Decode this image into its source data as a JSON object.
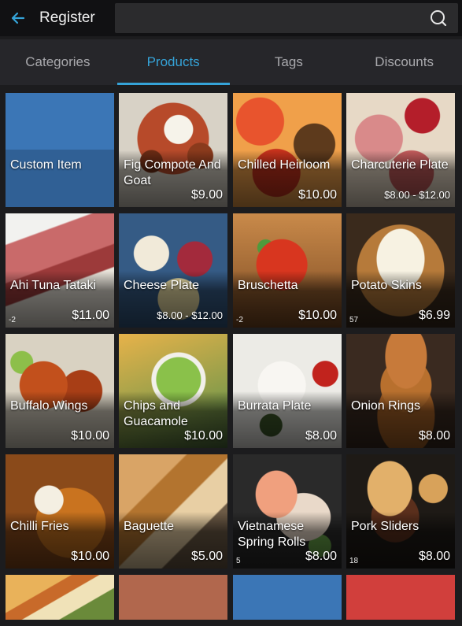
{
  "header": {
    "title": "Register",
    "search_placeholder": ""
  },
  "tabs": [
    {
      "label": "Categories",
      "active": false
    },
    {
      "label": "Products",
      "active": true
    },
    {
      "label": "Tags",
      "active": false
    },
    {
      "label": "Discounts",
      "active": false
    }
  ],
  "products": [
    {
      "name": "Custom Item",
      "price": "",
      "stock": "",
      "image": "solid-blue"
    },
    {
      "name": "Fig Compote And Goat",
      "price": "$9.00",
      "stock": "",
      "image": "fig-compote-photo"
    },
    {
      "name": "Chilled Heirloom",
      "price": "$10.00",
      "stock": "",
      "image": "heirloom-tomato-photo"
    },
    {
      "name": "Charcuterie Plate",
      "price": "$8.00 - $12.00",
      "stock": "",
      "image": "charcuterie-photo"
    },
    {
      "name": "Ahi Tuna Tataki",
      "price": "$11.00",
      "stock": "-2",
      "image": "tuna-photo"
    },
    {
      "name": "Cheese Plate",
      "price": "$8.00 - $12.00",
      "stock": "",
      "image": "cheese-photo"
    },
    {
      "name": "Bruschetta",
      "price": "$10.00",
      "stock": "-2",
      "image": "bruschetta-photo"
    },
    {
      "name": "Potato Skins",
      "price": "$6.99",
      "stock": "57",
      "image": "potato-skins-photo"
    },
    {
      "name": "Buffalo Wings",
      "price": "$10.00",
      "stock": "",
      "image": "wings-photo"
    },
    {
      "name": "Chips and Guacamole",
      "price": "$10.00",
      "stock": "",
      "image": "guacamole-photo"
    },
    {
      "name": "Burrata Plate",
      "price": "$8.00",
      "stock": "",
      "image": "burrata-photo"
    },
    {
      "name": "Onion Rings",
      "price": "$8.00",
      "stock": "",
      "image": "onion-rings-photo"
    },
    {
      "name": "Chilli Fries",
      "price": "$10.00",
      "stock": "",
      "image": "fries-photo"
    },
    {
      "name": "Baguette",
      "price": "$5.00",
      "stock": "",
      "image": "baguette-photo"
    },
    {
      "name": "Vietnamese Spring Rolls",
      "price": "$8.00",
      "stock": "5",
      "image": "spring-rolls-photo"
    },
    {
      "name": "Pork Sliders",
      "price": "$8.00",
      "stock": "18",
      "image": "sliders-photo"
    },
    {
      "name": "",
      "price": "",
      "stock": "",
      "image": "quesadilla-photo"
    },
    {
      "name": "",
      "price": "",
      "stock": "",
      "image": "solid-brown"
    },
    {
      "name": "",
      "price": "",
      "stock": "",
      "image": "solid-blue"
    },
    {
      "name": "",
      "price": "",
      "stock": "",
      "image": "solid-red"
    }
  ],
  "colors": {
    "accent": "#35a3d8",
    "blue_tile": "#3b76b6",
    "brown_tile": "#b1674d",
    "red_tile": "#d13f3c"
  }
}
